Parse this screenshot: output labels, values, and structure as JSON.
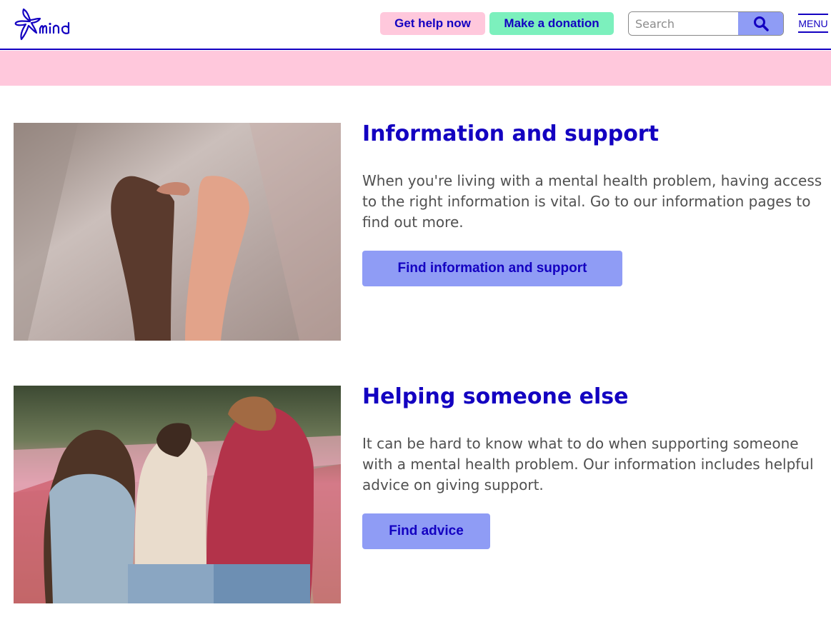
{
  "header": {
    "logo_text": "mind",
    "get_help_label": "Get help now",
    "donate_label": "Make a donation",
    "search": {
      "placeholder": "Search",
      "value": ""
    },
    "menu_label": "MENU"
  },
  "cards": [
    {
      "title": "Information and support",
      "text": "When you're living with a mental health problem, having access to the right information is vital. Go to our information pages to find out more.",
      "button_label": "Find information and support"
    },
    {
      "title": "Helping someone else",
      "text": "It can be hard to know what to do when supporting someone with a mental health problem. Our information includes helpful advice on giving support.",
      "button_label": "Find advice"
    }
  ],
  "colors": {
    "brand_blue": "#1300c1",
    "pink": "#ffc8dc",
    "green": "#7cf0bd",
    "button_lilac": "#8f9cf5"
  }
}
